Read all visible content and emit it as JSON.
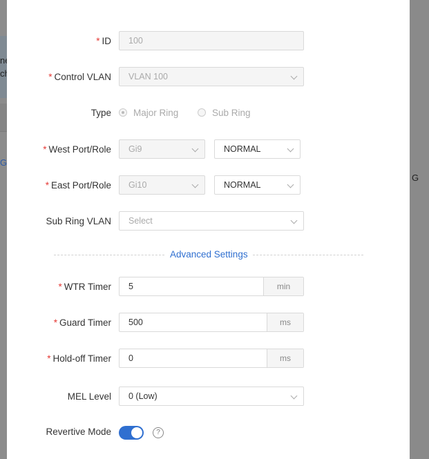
{
  "background": {
    "left_text_1": "ne",
    "left_text_2": "ch",
    "left_link": "G",
    "right_text": "G"
  },
  "form": {
    "id": {
      "label": "ID",
      "required": "*",
      "value": "100"
    },
    "control_vlan": {
      "label": "Control VLAN",
      "required": "*",
      "value": "VLAN 100"
    },
    "type": {
      "label": "Type",
      "options": [
        "Major Ring",
        "Sub Ring"
      ],
      "selected": "Major Ring"
    },
    "west_port": {
      "label": "West Port/Role",
      "required": "*",
      "port": "Gi9",
      "role": "NORMAL"
    },
    "east_port": {
      "label": "East Port/Role",
      "required": "*",
      "port": "Gi10",
      "role": "NORMAL"
    },
    "sub_ring_vlan": {
      "label": "Sub Ring VLAN",
      "placeholder": "Select"
    },
    "advanced_settings": "Advanced Settings",
    "wtr_timer": {
      "label": "WTR Timer",
      "required": "*",
      "value": "5",
      "unit": "min"
    },
    "guard_timer": {
      "label": "Guard Timer",
      "required": "*",
      "value": "500",
      "unit": "ms"
    },
    "holdoff_timer": {
      "label": "Hold-off Timer",
      "required": "*",
      "value": "0",
      "unit": "ms"
    },
    "mel_level": {
      "label": "MEL Level",
      "value": "0 (Low)"
    },
    "revertive_mode": {
      "label": "Revertive Mode",
      "enabled": true,
      "help": "?"
    }
  },
  "colors": {
    "accent": "#2f6fd0",
    "required": "#e53935"
  }
}
